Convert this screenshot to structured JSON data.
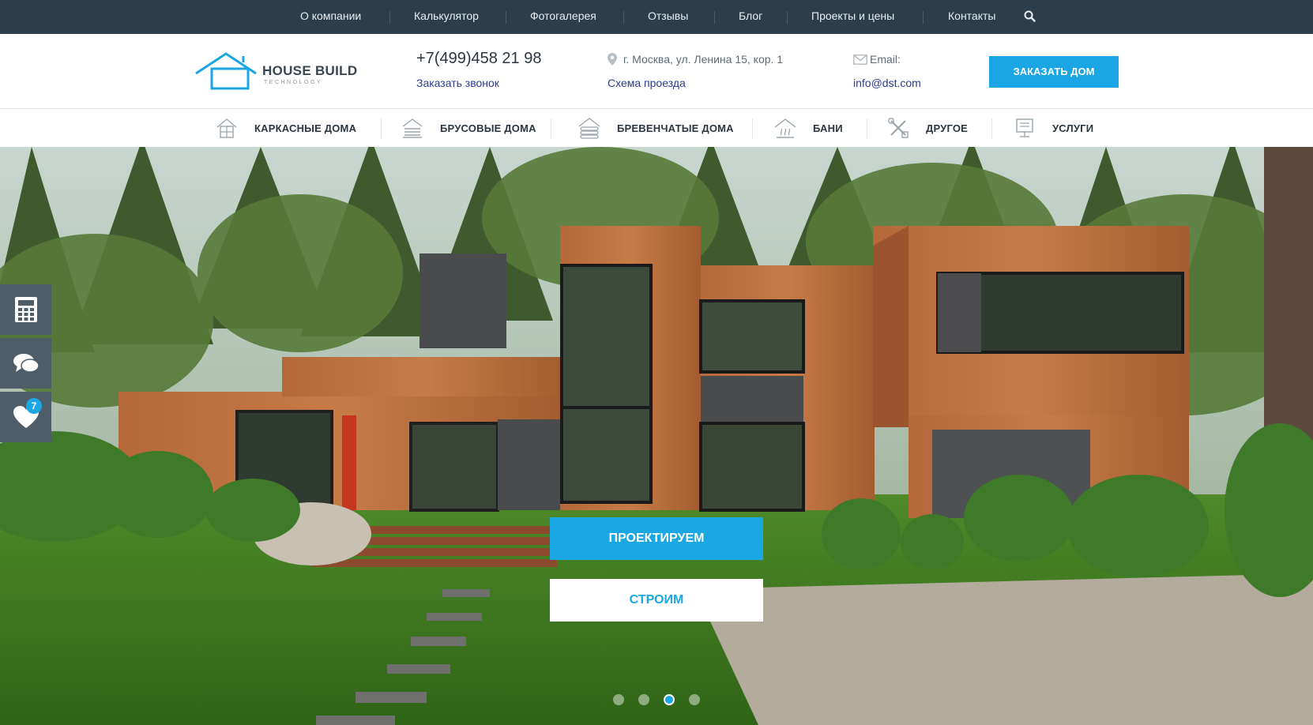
{
  "topnav": {
    "items": [
      "О компании",
      "Калькулятор",
      "Фотогалерея",
      "Отзывы",
      "Блог",
      "Проекты и цены",
      "Контакты"
    ],
    "search_icon": "search-icon"
  },
  "header": {
    "logo_title": "HOUSE BUILD",
    "logo_subtitle": "TECHNOLOGY",
    "phone": "+7(499)458 21 98",
    "callback_link": "Заказать звонок",
    "address": "г. Москва, ул. Ленина 15, кор. 1",
    "route_link": "Схема проезда",
    "email_label": "Email:",
    "email_value": "info@dst.com",
    "order_button": "ЗАКАЗАТЬ ДОМ"
  },
  "categories": [
    {
      "label": "КАРКАСНЫЕ ДОМА",
      "icon": "frame-house-icon"
    },
    {
      "label": "БРУСОВЫЕ ДОМА",
      "icon": "timber-house-icon"
    },
    {
      "label": "БРЕВЕНЧАТЫЕ ДОМА",
      "icon": "log-house-icon"
    },
    {
      "label": "БАНИ",
      "icon": "sauna-icon"
    },
    {
      "label": "ДРУГОЕ",
      "icon": "tools-icon"
    },
    {
      "label": "УСЛУГИ",
      "icon": "services-icon"
    }
  ],
  "hero": {
    "cta_primary": "ПРОЕКТИРУЕМ",
    "cta_secondary": "СТРОИМ",
    "slides_count": 4,
    "active_slide": 3
  },
  "side_widgets": {
    "calculator_icon": "calculator-icon",
    "chat_icon": "chat-icon",
    "favorites_icon": "heart-icon",
    "favorites_count": "7"
  },
  "colors": {
    "topbar": "#2c3e4a",
    "accent": "#1aa6e4",
    "link": "#2d3b8a",
    "side_widget": "#4e5d68"
  }
}
